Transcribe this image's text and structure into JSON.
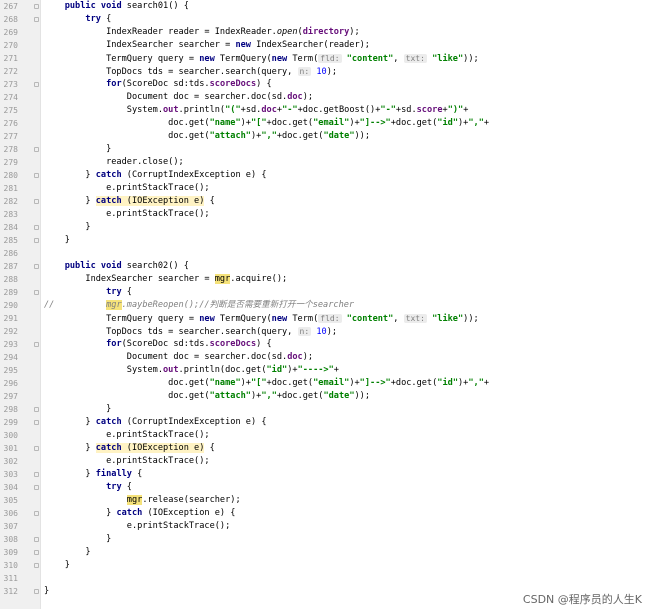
{
  "lines": [
    {
      "n": "267",
      "segs": [
        [
          "    ",
          ""
        ],
        [
          "public void ",
          "kw"
        ],
        [
          "search01() {",
          ""
        ]
      ]
    },
    {
      "n": "268",
      "segs": [
        [
          "        ",
          ""
        ],
        [
          "try ",
          "kw"
        ],
        [
          "{",
          ""
        ]
      ]
    },
    {
      "n": "269",
      "segs": [
        [
          "            IndexReader reader = IndexReader.",
          ""
        ],
        [
          "open",
          "ital"
        ],
        [
          "(",
          ""
        ],
        [
          "directory",
          "field"
        ],
        [
          ");",
          ""
        ]
      ]
    },
    {
      "n": "270",
      "segs": [
        [
          "            IndexSearcher searcher = ",
          ""
        ],
        [
          "new ",
          "kw"
        ],
        [
          "IndexSearcher(reader);",
          ""
        ]
      ]
    },
    {
      "n": "271",
      "segs": [
        [
          "            TermQuery query = ",
          ""
        ],
        [
          "new ",
          "kw"
        ],
        [
          "TermQuery(",
          ""
        ],
        [
          "new ",
          "kw"
        ],
        [
          "Term(",
          ""
        ],
        [
          "fld:",
          "hint"
        ],
        [
          " ",
          ""
        ],
        [
          "\"content\"",
          "str"
        ],
        [
          ", ",
          ""
        ],
        [
          "txt:",
          "hint"
        ],
        [
          " ",
          ""
        ],
        [
          "\"like\"",
          "str"
        ],
        [
          "));",
          ""
        ]
      ]
    },
    {
      "n": "272",
      "segs": [
        [
          "            TopDocs tds = searcher.search(query, ",
          ""
        ],
        [
          "n:",
          "hint"
        ],
        [
          " ",
          ""
        ],
        [
          "10",
          "num"
        ],
        [
          ");",
          ""
        ]
      ]
    },
    {
      "n": "273",
      "segs": [
        [
          "            ",
          ""
        ],
        [
          "for",
          "kw"
        ],
        [
          "(ScoreDoc sd:tds.",
          ""
        ],
        [
          "scoreDocs",
          "field"
        ],
        [
          ") {",
          ""
        ]
      ]
    },
    {
      "n": "274",
      "segs": [
        [
          "                Document doc = searcher.doc(sd.",
          ""
        ],
        [
          "doc",
          "field"
        ],
        [
          ");",
          ""
        ]
      ]
    },
    {
      "n": "275",
      "segs": [
        [
          "                System.",
          ""
        ],
        [
          "out",
          "field"
        ],
        [
          ".println(",
          ""
        ],
        [
          "\"(\"",
          "str"
        ],
        [
          "+sd.",
          ""
        ],
        [
          "doc",
          "field"
        ],
        [
          "+",
          ""
        ],
        [
          "\"-\"",
          "str"
        ],
        [
          "+doc.getBoost()+",
          ""
        ],
        [
          "\"-\"",
          "str"
        ],
        [
          "+sd.",
          ""
        ],
        [
          "score",
          "field"
        ],
        [
          "+",
          ""
        ],
        [
          "\")\"",
          "str"
        ],
        [
          "+",
          ""
        ]
      ]
    },
    {
      "n": "276",
      "segs": [
        [
          "                        doc.get(",
          ""
        ],
        [
          "\"name\"",
          "str"
        ],
        [
          ")+",
          ""
        ],
        [
          "\"[\"",
          "str"
        ],
        [
          "+doc.get(",
          ""
        ],
        [
          "\"email\"",
          "str"
        ],
        [
          ")+",
          ""
        ],
        [
          "\"]-->\"",
          "str"
        ],
        [
          "+doc.get(",
          ""
        ],
        [
          "\"id\"",
          "str"
        ],
        [
          ")+",
          ""
        ],
        [
          "\",\"",
          "str"
        ],
        [
          "+",
          ""
        ]
      ]
    },
    {
      "n": "277",
      "segs": [
        [
          "                        doc.get(",
          ""
        ],
        [
          "\"attach\"",
          "str"
        ],
        [
          ")+",
          ""
        ],
        [
          "\",\"",
          "str"
        ],
        [
          "+doc.get(",
          ""
        ],
        [
          "\"date\"",
          "str"
        ],
        [
          "));",
          ""
        ]
      ]
    },
    {
      "n": "278",
      "segs": [
        [
          "            }",
          ""
        ]
      ]
    },
    {
      "n": "279",
      "segs": [
        [
          "            reader.close();",
          ""
        ]
      ]
    },
    {
      "n": "280",
      "segs": [
        [
          "        } ",
          ""
        ],
        [
          "catch ",
          "kw"
        ],
        [
          "(CorruptIndexException e) {",
          ""
        ]
      ]
    },
    {
      "n": "281",
      "segs": [
        [
          "            e.printStackTrace();",
          ""
        ]
      ]
    },
    {
      "n": "282",
      "segs": [
        [
          "        } ",
          ""
        ],
        [
          "catch",
          "kw hlc"
        ],
        [
          " (IOException e)",
          "hlc"
        ],
        [
          " {",
          ""
        ]
      ]
    },
    {
      "n": "283",
      "segs": [
        [
          "            e.printStackTrace();",
          ""
        ]
      ]
    },
    {
      "n": "284",
      "segs": [
        [
          "        }",
          ""
        ]
      ]
    },
    {
      "n": "285",
      "segs": [
        [
          "    }",
          ""
        ]
      ]
    },
    {
      "n": "286",
      "segs": [
        [
          "",
          ""
        ]
      ]
    },
    {
      "n": "287",
      "segs": [
        [
          "    ",
          ""
        ],
        [
          "public void ",
          "kw"
        ],
        [
          "search02() {",
          ""
        ]
      ]
    },
    {
      "n": "288",
      "segs": [
        [
          "        IndexSearcher searcher = ",
          ""
        ],
        [
          "mgr",
          "hl"
        ],
        [
          ".acquire();",
          ""
        ]
      ]
    },
    {
      "n": "289",
      "segs": [
        [
          "            ",
          ""
        ],
        [
          "try ",
          "kw"
        ],
        [
          "{",
          ""
        ]
      ]
    },
    {
      "n": "290",
      "segs": [
        [
          "//          ",
          "cmt"
        ],
        [
          "mgr",
          "hl cmt"
        ],
        [
          ".maybeReopen();//判断是否需要重新打开一个searcher",
          "cmt"
        ]
      ]
    },
    {
      "n": "291",
      "segs": [
        [
          "            TermQuery query = ",
          ""
        ],
        [
          "new ",
          "kw"
        ],
        [
          "TermQuery(",
          ""
        ],
        [
          "new ",
          "kw"
        ],
        [
          "Term(",
          ""
        ],
        [
          "fld:",
          "hint"
        ],
        [
          " ",
          ""
        ],
        [
          "\"content\"",
          "str"
        ],
        [
          ", ",
          ""
        ],
        [
          "txt:",
          "hint"
        ],
        [
          " ",
          ""
        ],
        [
          "\"like\"",
          "str"
        ],
        [
          "));",
          ""
        ]
      ]
    },
    {
      "n": "292",
      "segs": [
        [
          "            TopDocs tds = searcher.search(query, ",
          ""
        ],
        [
          "n:",
          "hint"
        ],
        [
          " ",
          ""
        ],
        [
          "10",
          "num"
        ],
        [
          ");",
          ""
        ]
      ]
    },
    {
      "n": "293",
      "segs": [
        [
          "            ",
          ""
        ],
        [
          "for",
          "kw"
        ],
        [
          "(ScoreDoc sd:tds.",
          ""
        ],
        [
          "scoreDocs",
          "field"
        ],
        [
          ") {",
          ""
        ]
      ]
    },
    {
      "n": "294",
      "segs": [
        [
          "                Document doc = searcher.doc(sd.",
          ""
        ],
        [
          "doc",
          "field"
        ],
        [
          ");",
          ""
        ]
      ]
    },
    {
      "n": "295",
      "segs": [
        [
          "                System.",
          ""
        ],
        [
          "out",
          "field"
        ],
        [
          ".println(doc.get(",
          ""
        ],
        [
          "\"id\"",
          "str"
        ],
        [
          ")+",
          ""
        ],
        [
          "\"---->\"",
          "str"
        ],
        [
          "+",
          ""
        ]
      ]
    },
    {
      "n": "296",
      "segs": [
        [
          "                        doc.get(",
          ""
        ],
        [
          "\"name\"",
          "str"
        ],
        [
          ")+",
          ""
        ],
        [
          "\"[\"",
          "str"
        ],
        [
          "+doc.get(",
          ""
        ],
        [
          "\"email\"",
          "str"
        ],
        [
          ")+",
          ""
        ],
        [
          "\"]-->\"",
          "str"
        ],
        [
          "+doc.get(",
          ""
        ],
        [
          "\"id\"",
          "str"
        ],
        [
          ")+",
          ""
        ],
        [
          "\",\"",
          "str"
        ],
        [
          "+",
          ""
        ]
      ]
    },
    {
      "n": "297",
      "segs": [
        [
          "                        doc.get(",
          ""
        ],
        [
          "\"attach\"",
          "str"
        ],
        [
          ")+",
          ""
        ],
        [
          "\",\"",
          "str"
        ],
        [
          "+doc.get(",
          ""
        ],
        [
          "\"date\"",
          "str"
        ],
        [
          "));",
          ""
        ]
      ]
    },
    {
      "n": "298",
      "segs": [
        [
          "            }",
          ""
        ]
      ]
    },
    {
      "n": "299",
      "segs": [
        [
          "        } ",
          ""
        ],
        [
          "catch ",
          "kw"
        ],
        [
          "(CorruptIndexException e) {",
          ""
        ]
      ]
    },
    {
      "n": "300",
      "segs": [
        [
          "            e.printStackTrace();",
          ""
        ]
      ]
    },
    {
      "n": "301",
      "segs": [
        [
          "        } ",
          ""
        ],
        [
          "catch",
          "kw hlc"
        ],
        [
          " (IOException e)",
          "hlc"
        ],
        [
          " {",
          ""
        ]
      ]
    },
    {
      "n": "302",
      "segs": [
        [
          "            e.printStackTrace();",
          ""
        ]
      ]
    },
    {
      "n": "303",
      "segs": [
        [
          "        } ",
          ""
        ],
        [
          "finally ",
          "kw"
        ],
        [
          "{",
          ""
        ]
      ]
    },
    {
      "n": "304",
      "segs": [
        [
          "            ",
          ""
        ],
        [
          "try ",
          "kw"
        ],
        [
          "{",
          ""
        ]
      ]
    },
    {
      "n": "305",
      "segs": [
        [
          "                ",
          ""
        ],
        [
          "mgr",
          "hl"
        ],
        [
          ".release(searcher);",
          ""
        ]
      ]
    },
    {
      "n": "306",
      "segs": [
        [
          "            } ",
          ""
        ],
        [
          "catch ",
          "kw"
        ],
        [
          "(IOException e) {",
          ""
        ]
      ]
    },
    {
      "n": "307",
      "segs": [
        [
          "                e.printStackTrace();",
          ""
        ]
      ]
    },
    {
      "n": "308",
      "segs": [
        [
          "            }",
          ""
        ]
      ]
    },
    {
      "n": "309",
      "segs": [
        [
          "        }",
          ""
        ]
      ]
    },
    {
      "n": "310",
      "segs": [
        [
          "    }",
          ""
        ]
      ]
    },
    {
      "n": "311",
      "segs": [
        [
          "",
          ""
        ]
      ]
    },
    {
      "n": "312",
      "segs": [
        [
          "}",
          ""
        ]
      ]
    }
  ],
  "fold_markers": [
    "267",
    "268",
    "273",
    "278",
    "280",
    "282",
    "284",
    "285",
    "287",
    "289",
    "293",
    "298",
    "299",
    "301",
    "303",
    "304",
    "306",
    "308",
    "309",
    "310",
    "312"
  ],
  "watermark": "CSDN @程序员的人生K",
  "colors": {
    "keyword": "#000080",
    "string": "#008000",
    "field": "#660e7a",
    "number": "#0000ff",
    "highlight": "#f5e27a",
    "gutter": "#f0f0f0"
  }
}
